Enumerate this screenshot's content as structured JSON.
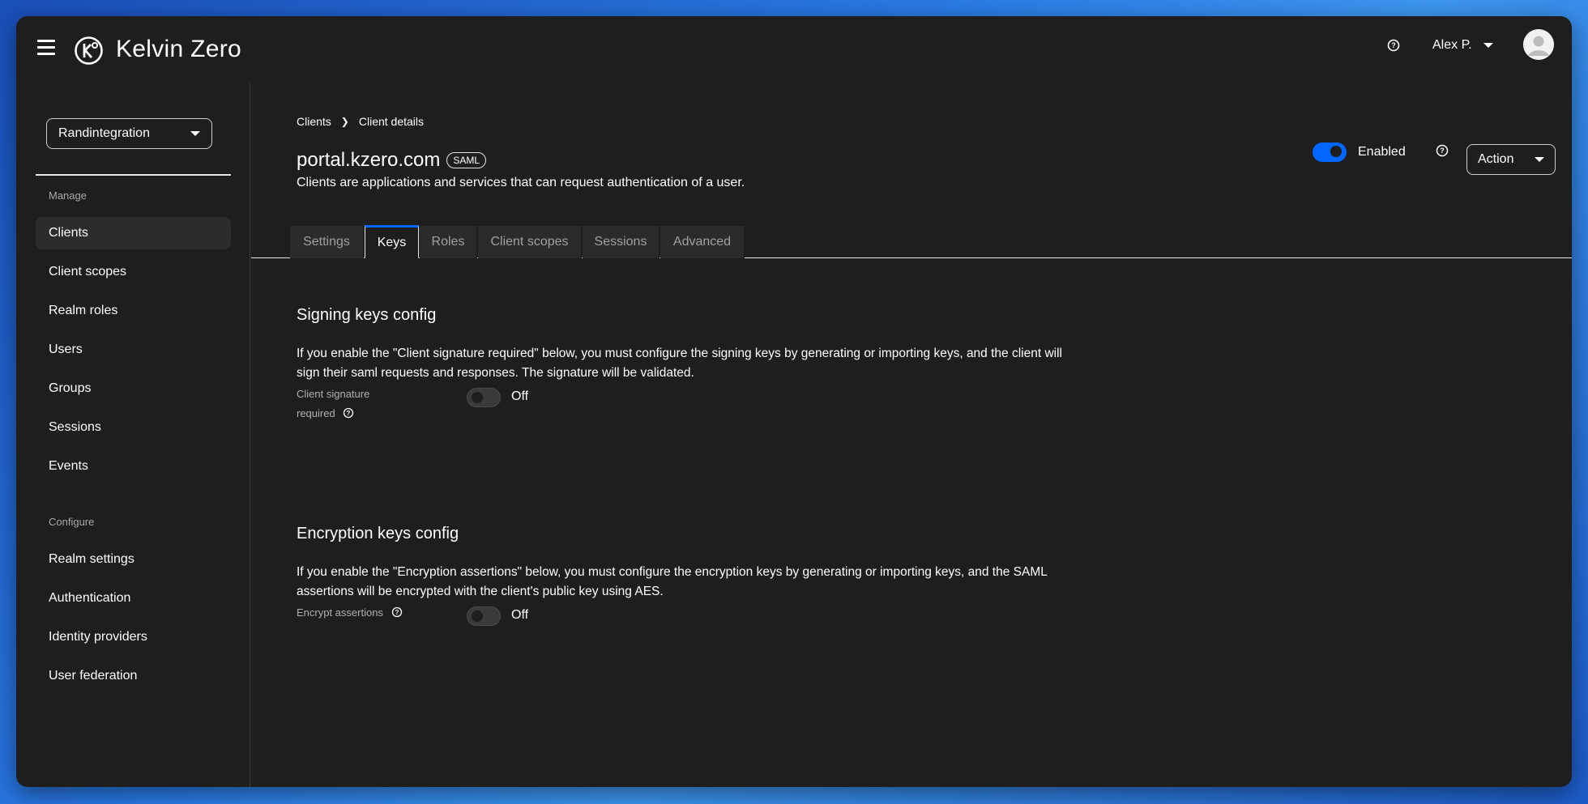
{
  "header": {
    "brand": "Kelvin Zero",
    "user_name": "Alex P."
  },
  "sidebar": {
    "realm": "Randintegration",
    "manage_title": "Manage",
    "manage_items": [
      "Clients",
      "Client scopes",
      "Realm roles",
      "Users",
      "Groups",
      "Sessions",
      "Events"
    ],
    "configure_title": "Configure",
    "configure_items": [
      "Realm settings",
      "Authentication",
      "Identity providers",
      "User federation"
    ],
    "active_item": "Clients"
  },
  "breadcrumb": {
    "parent": "Clients",
    "current": "Client details"
  },
  "client": {
    "name": "portal.kzero.com",
    "protocol_badge": "SAML",
    "description": "Clients are applications and services that can request authentication of a user.",
    "enabled_label": "Enabled",
    "enabled": true,
    "action_label": "Action"
  },
  "tabs": {
    "items": [
      "Settings",
      "Keys",
      "Roles",
      "Client scopes",
      "Sessions",
      "Advanced"
    ],
    "active": "Keys"
  },
  "signing": {
    "heading": "Signing keys config",
    "description": "If you enable the \"Client signature required\" below, you must configure the signing keys by generating or importing keys, and the client will sign their saml requests and responses. The signature will be validated.",
    "field_label_line1": "Client signature",
    "field_label_line2": "required",
    "state": "Off"
  },
  "encryption": {
    "heading": "Encryption keys config",
    "description": "If you enable the \"Encryption assertions\" below, you must configure the encryption keys by generating or importing keys, and the SAML assertions will be encrypted with the client's public key using AES.",
    "field_label": "Encrypt assertions",
    "state": "Off"
  },
  "colors": {
    "accent": "#0066ff",
    "panel": "#1e1e1e",
    "nav_active": "#2c2c2c"
  }
}
